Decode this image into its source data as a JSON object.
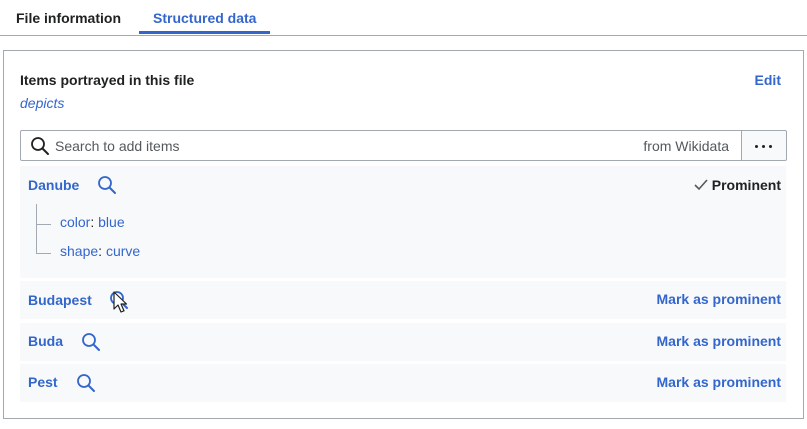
{
  "tabs": [
    {
      "label": "File information",
      "active": false
    },
    {
      "label": "Structured data",
      "active": true
    }
  ],
  "panel": {
    "title": "Items portrayed in this file",
    "property": "depicts",
    "edit_label": "Edit"
  },
  "search": {
    "placeholder": "Search to add items",
    "source": "from Wikidata"
  },
  "items": [
    {
      "name": "Danube",
      "prominence_label": "Prominent",
      "prominent": true,
      "qualifiers": [
        {
          "property": "color",
          "value": "blue"
        },
        {
          "property": "shape",
          "value": "curve"
        }
      ]
    },
    {
      "name": "Budapest",
      "prominence_label": "Mark as prominent",
      "prominent": false
    },
    {
      "name": "Buda",
      "prominence_label": "Mark as prominent",
      "prominent": false
    },
    {
      "name": "Pest",
      "prominence_label": "Mark as prominent",
      "prominent": false
    }
  ],
  "colors": {
    "link": "#3366cc",
    "text": "#202122",
    "border": "#a2a9b1",
    "item_bg": "#f8f9fa"
  }
}
